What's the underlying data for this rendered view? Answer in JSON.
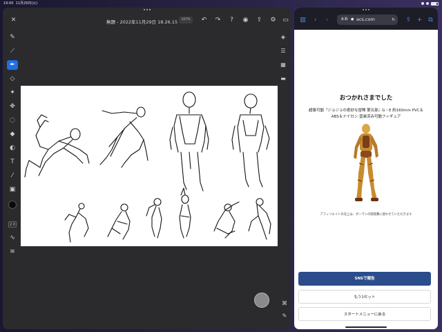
{
  "status_bar": {
    "time": "19:00",
    "date": "11月29日(火)"
  },
  "drawing_app": {
    "title": "無題 - 2022年11月29日 18.26.15",
    "zoom": "107%",
    "brush_size": "2.0",
    "primary_color": "#0a0a0a",
    "accent_color": "#1f6fe6",
    "tools": [
      "brush-icon",
      "smudge-icon",
      "pen-icon",
      "eraser-icon",
      "liquify-icon",
      "transform-icon",
      "lasso-icon",
      "fill-icon",
      "mask-icon",
      "text-icon",
      "eyedropper-icon",
      "image-icon"
    ],
    "right_tools": [
      "layers-icon",
      "adjustments-icon",
      "grid-icon",
      "comment-icon"
    ]
  },
  "browser": {
    "url_host": "acs.com",
    "url_aa": "ぁあ",
    "page": {
      "heading": "おつかれさまでした",
      "product_line1": "超像可動『ジョジョの奇妙な冒険 第五部』G・E 約160mm PVC＆",
      "product_line2": "ABS＆ナイロン 塗装済み可動フィギュア",
      "disclaimer": "アフィリエイトの売上は、ポーマンの開発費に使わせていただきます",
      "buttons": {
        "share": "SNSで報告",
        "again": "もう1セット",
        "menu": "スタートメニューに戻る"
      }
    },
    "primary_button_color": "#2c4d8c"
  }
}
